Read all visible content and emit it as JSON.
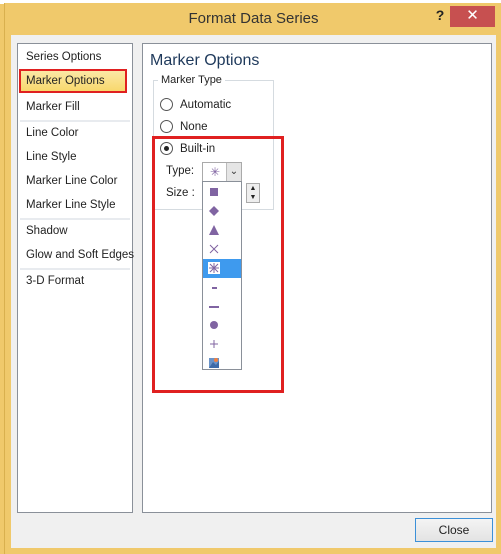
{
  "dialog": {
    "title": "Format Data Series",
    "help_label": "?",
    "close_x": "✕"
  },
  "nav": {
    "items": [
      {
        "label": "Series Options"
      },
      {
        "label": "Marker Options",
        "selected": true
      },
      {
        "label": "Marker Fill"
      },
      {
        "label": "Line Color"
      },
      {
        "label": "Line Style"
      },
      {
        "label": "Marker Line Color"
      },
      {
        "label": "Marker Line Style"
      },
      {
        "label": "Shadow"
      },
      {
        "label": "Glow and Soft Edges"
      },
      {
        "label": "3-D Format"
      }
    ]
  },
  "panel": {
    "title": "Marker Options",
    "group_label": "Marker Type",
    "radios": [
      {
        "label": "Automatic",
        "checked": false
      },
      {
        "label": "None",
        "checked": false
      },
      {
        "label": "Built-in",
        "checked": true
      }
    ],
    "type_label": "Type:",
    "size_label": "Size :",
    "type_selected": "✳",
    "marker_color": "#8064a2",
    "dropdown_options": [
      "square",
      "diamond",
      "triangle",
      "x",
      "star",
      "short-dash",
      "long-dash",
      "circle",
      "plus",
      "picture"
    ],
    "dropdown_highlighted": "star"
  },
  "footer": {
    "close_label": "Close"
  }
}
